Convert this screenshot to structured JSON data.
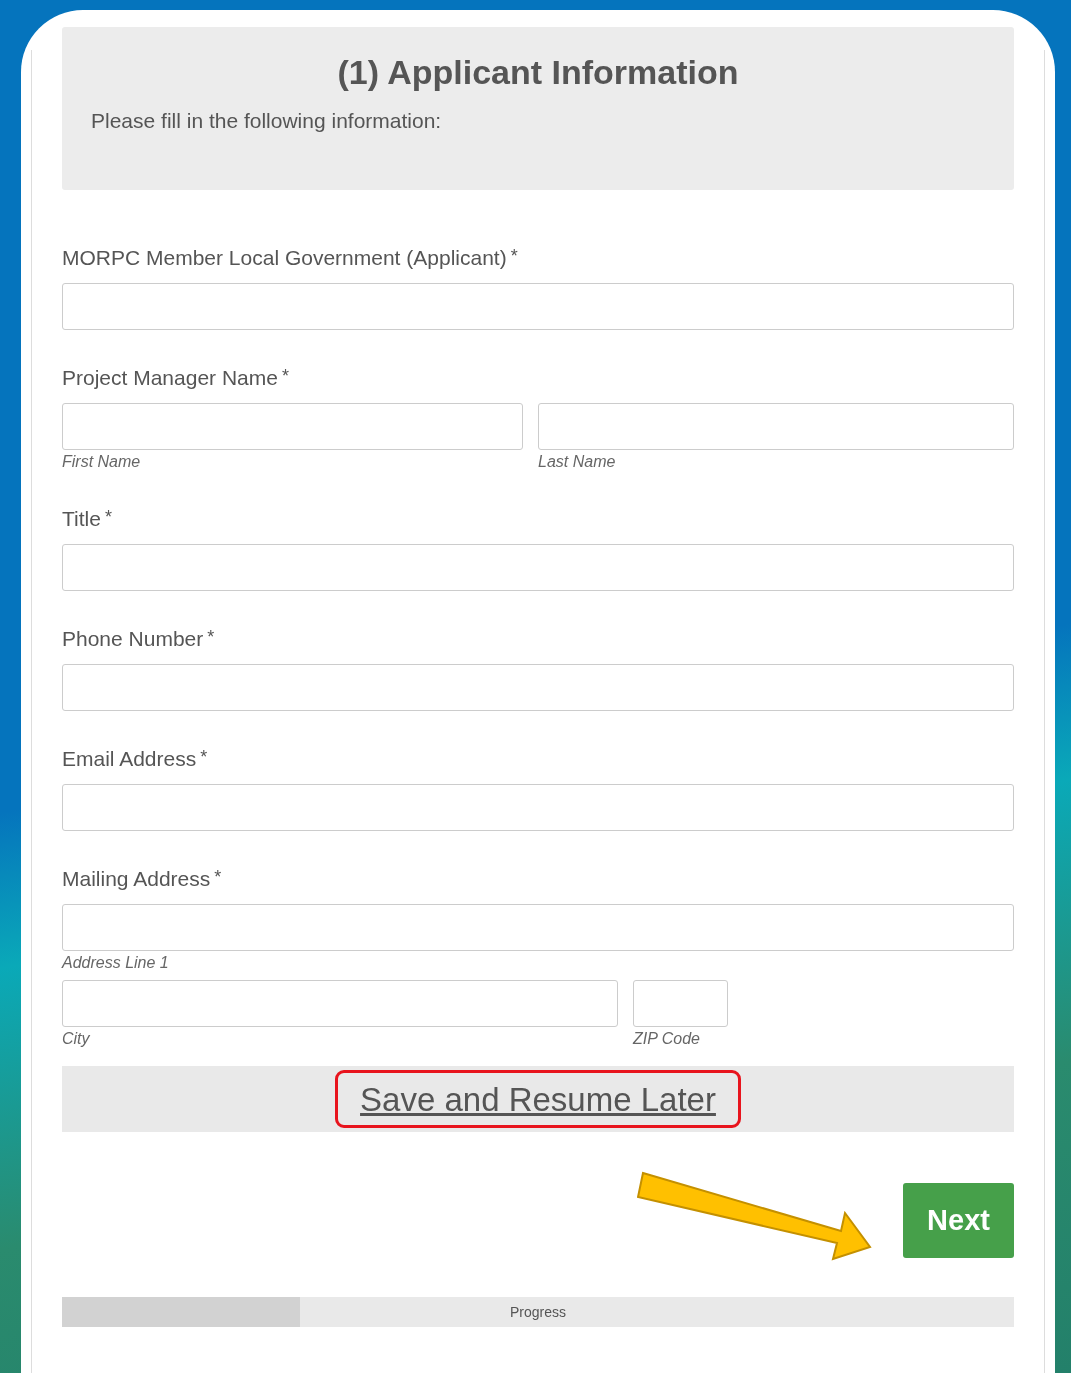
{
  "section": {
    "title": "(1) Applicant Information",
    "intro": "Please fill in the following information:"
  },
  "fields": [
    {
      "label": "MORPC Member Local Government (Applicant)",
      "required_mark": "*",
      "rows": [
        {
          "kind": "full"
        }
      ]
    },
    {
      "label": "Project Manager Name",
      "required_mark": "*",
      "rows": [
        {
          "kind": "split",
          "sublabels": [
            "First Name",
            "Last Name"
          ]
        }
      ]
    },
    {
      "label": "Title",
      "required_mark": "*",
      "rows": [
        {
          "kind": "full"
        }
      ]
    },
    {
      "label": "Phone Number",
      "required_mark": "*",
      "rows": [
        {
          "kind": "full"
        }
      ]
    },
    {
      "label": "Email Address",
      "required_mark": "*",
      "rows": [
        {
          "kind": "full"
        }
      ]
    },
    {
      "label": "Mailing Address",
      "required_mark": "*",
      "rows": [
        {
          "kind": "full",
          "sublabels": [
            "Address Line 1"
          ]
        },
        {
          "kind": "city-zip",
          "sublabels": [
            "City",
            "ZIP Code"
          ]
        }
      ]
    }
  ],
  "save_link": {
    "label": "Save and Resume Later",
    "highlighted": true
  },
  "next_button": {
    "label": "Next",
    "pointer_arrow": true
  },
  "progress": {
    "label": "Progress",
    "level": 0.25
  }
}
